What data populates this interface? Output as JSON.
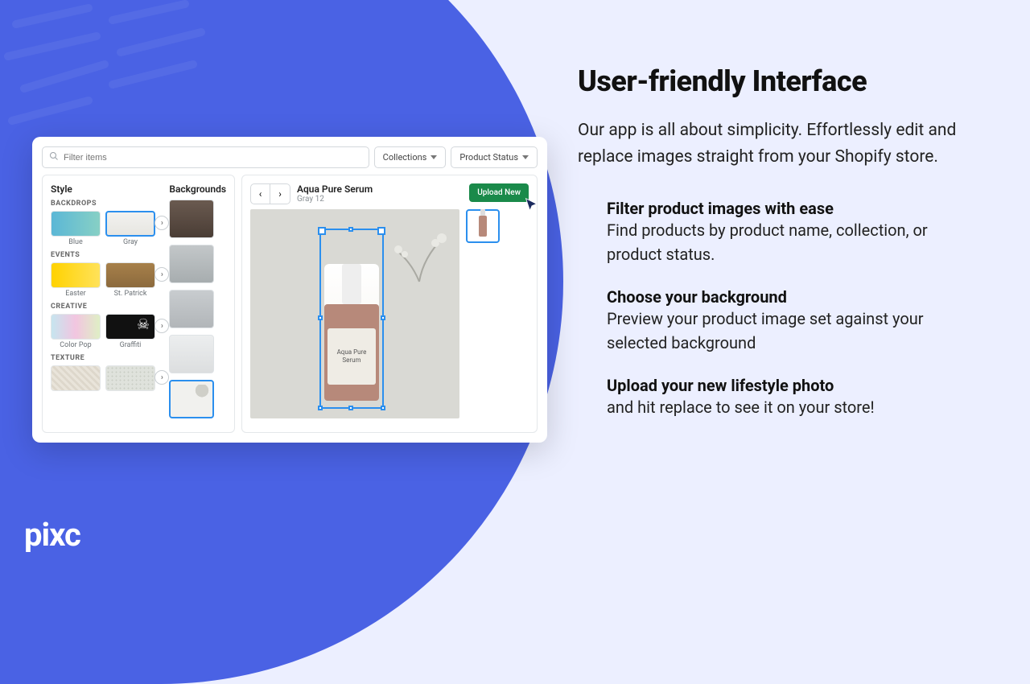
{
  "brand": {
    "logo": "pixc",
    "accent": "#4a62e4",
    "cta_green": "#1a8a4a"
  },
  "marketing": {
    "headline": "User-friendly Interface",
    "subhead": "Our app is all about simplicity. Effortlessly edit and replace images straight from your Shopify store.",
    "features": [
      {
        "title": "Filter product images with ease",
        "body": "Find products by product name, collection, or product status."
      },
      {
        "title": "Choose your background",
        "body": "Preview your product image set against your selected background"
      },
      {
        "title": "Upload your new lifestyle photo",
        "body": "and hit replace to see it on your store!"
      }
    ]
  },
  "app": {
    "filter_placeholder": "Filter items",
    "dropdowns": {
      "collections": "Collections",
      "status": "Product Status"
    },
    "style_panel": {
      "title": "Style",
      "backgrounds_title": "Backgrounds",
      "categories": [
        {
          "label": "BACKDROPS",
          "items": [
            {
              "name": "Blue",
              "selected": false
            },
            {
              "name": "Gray",
              "selected": true
            }
          ]
        },
        {
          "label": "EVENTS",
          "items": [
            {
              "name": "Easter",
              "selected": false
            },
            {
              "name": "St. Patrick",
              "selected": false
            }
          ]
        },
        {
          "label": "CREATIVE",
          "items": [
            {
              "name": "Color Pop",
              "selected": false
            },
            {
              "name": "Graffiti",
              "selected": false
            }
          ]
        },
        {
          "label": "TEXTURE",
          "items": [
            {
              "name": "",
              "selected": false
            },
            {
              "name": "",
              "selected": false
            }
          ]
        }
      ],
      "background_thumbs": 5,
      "background_selected_index": 4
    },
    "preview": {
      "product_name": "Aqua Pure Serum",
      "variant": "Gray 12",
      "upload_label": "Upload New",
      "bottle_label": "Aqua Pure Serum"
    }
  }
}
